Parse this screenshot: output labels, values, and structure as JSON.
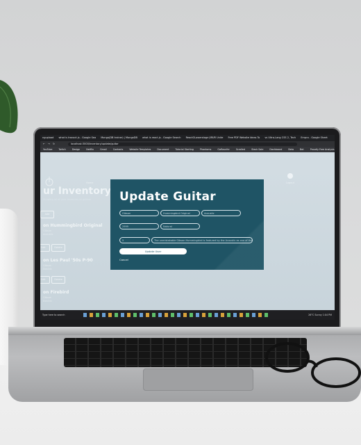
{
  "browser": {
    "tabs": [
      "ngupload",
      "what is tranact.js - Google Sea",
      "Mongo(DB trainer) | MongoDB",
      "what is react.js - Google Search",
      "ReactGLowerstage JIRUR Unite",
      "Free PDF Website Ideas To",
      "vs Ultra-Lang CSS 2, Tech",
      "Ernpro - Google Sheet"
    ],
    "url": "localhost:3000/inventory/update/guitar",
    "bookmarks": [
      "YouTube",
      "Twitch",
      "Design",
      "Netflix",
      "Gmail",
      "Contacts",
      "Website Templates",
      "Document",
      "Tutorial Starting",
      "Phantoms",
      "Gaflaunfer",
      "Scrolled",
      "Stack Sale",
      "Dashboard",
      "Beta",
      "Bot",
      "Proudly Free Analysis"
    ]
  },
  "site": {
    "nav_left": "Home",
    "nav_right": "Logout",
    "page_title": "ur Inventory",
    "page_subtitle": "Showing all of your inventory of guitars",
    "add_button": "Add",
    "guitars": [
      {
        "name": "on Hummingbird Original",
        "meta1": "Gibson",
        "meta2": "Acoustic",
        "edit": "Edit",
        "delete": "Delete"
      },
      {
        "name": "on Les Paul '50s P-90",
        "meta1": "Gibson",
        "meta2": "Electric",
        "edit": "Edit",
        "delete": "Delete"
      },
      {
        "name": "on Firebird",
        "meta1": "Gibson",
        "meta2": "Electric"
      }
    ]
  },
  "modal": {
    "title": "Update Guitar",
    "fields": {
      "brand": "Gibson",
      "model": "Hummingbird Original",
      "type": "Acoustic",
      "price": "2999",
      "color": "Natural",
      "quantity": "5",
      "description": "The unmistakable Gibson Hummingbird is featured by the Acoustic as one of the more"
    },
    "submit_label": "Update User",
    "cancel_label": "Cancel"
  },
  "taskbar": {
    "search": "Type here to search",
    "weather": "26°C Sunny",
    "time": "1:04 PM"
  },
  "colors": {
    "modal_bg": "#1f5465",
    "page_bg": "#c6d2d9",
    "wall": "#d2d3d4"
  }
}
